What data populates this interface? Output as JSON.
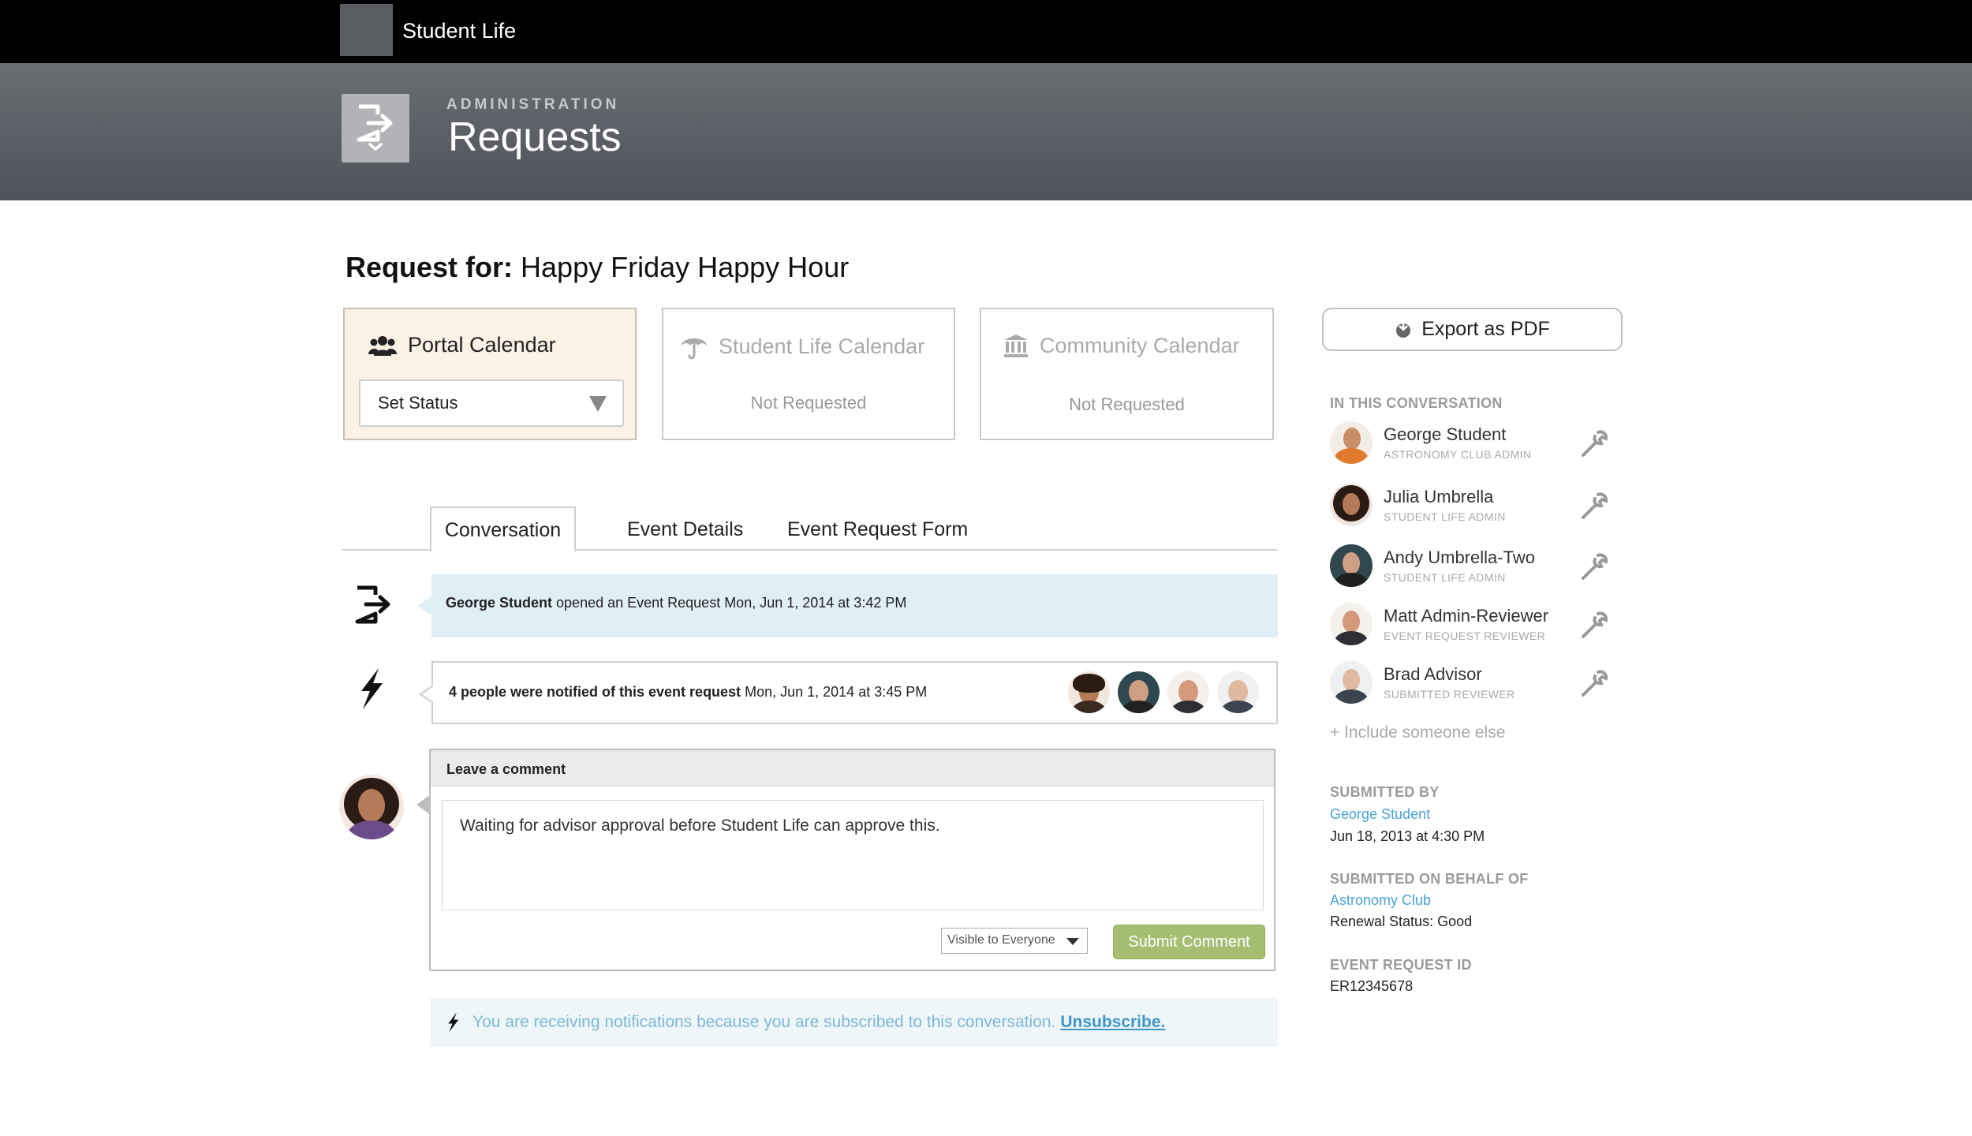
{
  "topbar": {
    "app_title": "Student Life"
  },
  "header": {
    "kicker": "ADMINISTRATION",
    "title": "Requests"
  },
  "request": {
    "label": "Request for:",
    "name": "Happy Friday Happy Hour"
  },
  "calendars": [
    {
      "name": "Portal Calendar",
      "status_select": "Set Status",
      "icon": "people-icon"
    },
    {
      "name": "Student Life Calendar",
      "status": "Not Requested",
      "icon": "umbrella-icon"
    },
    {
      "name": "Community Calendar",
      "status": "Not Requested",
      "icon": "bank-icon"
    }
  ],
  "tabs": {
    "conversation": "Conversation",
    "details": "Event Details",
    "form": "Event Request Form"
  },
  "timeline": {
    "opened": {
      "actor": "George Student",
      "text": "opened an Event Request Mon, Jun 1, 2014 at 3:42 PM"
    },
    "notified": {
      "bold": "4 people were notified of this event request",
      "text": "Mon, Jun 1, 2014 at 3:45 PM"
    }
  },
  "comment": {
    "header": "Leave a comment",
    "text": "Waiting for advisor approval before Student Life can approve this.",
    "visibility": "Visible to Everyone",
    "submit": "Submit Comment"
  },
  "notify": {
    "text": "You are receiving notifications because you are subscribed to this conversation.",
    "unsubscribe": "Unsubscribe."
  },
  "sidebar": {
    "export": "Export as PDF",
    "conversation_label": "IN THIS CONVERSATION",
    "people": [
      {
        "name": "George Student",
        "role": "ASTRONOMY CLUB ADMIN"
      },
      {
        "name": "Julia Umbrella",
        "role": "STUDENT LIFE ADMIN"
      },
      {
        "name": "Andy Umbrella-Two",
        "role": "STUDENT LIFE ADMIN"
      },
      {
        "name": "Matt Admin-Reviewer",
        "role": "EVENT REQUEST REVIEWER"
      },
      {
        "name": "Brad Advisor",
        "role": "SUBMITTED REVIEWER"
      }
    ],
    "include": "+ Include someone else",
    "submitted_by_label": "SUBMITTED BY",
    "submitted_by": "George Student",
    "submitted_date": "Jun 18, 2013 at 4:30 PM",
    "behalf_label": "SUBMITTED ON BEHALF OF",
    "behalf": "Astronomy Club",
    "renewal": "Renewal Status: Good",
    "id_label": "EVENT REQUEST ID",
    "id": "ER12345678"
  },
  "colors": {
    "accent_green": "#a5bf72",
    "link_blue": "#4aa3d8",
    "portal_bg": "#fbf1e4",
    "bubble_blue": "#e0eef6"
  }
}
